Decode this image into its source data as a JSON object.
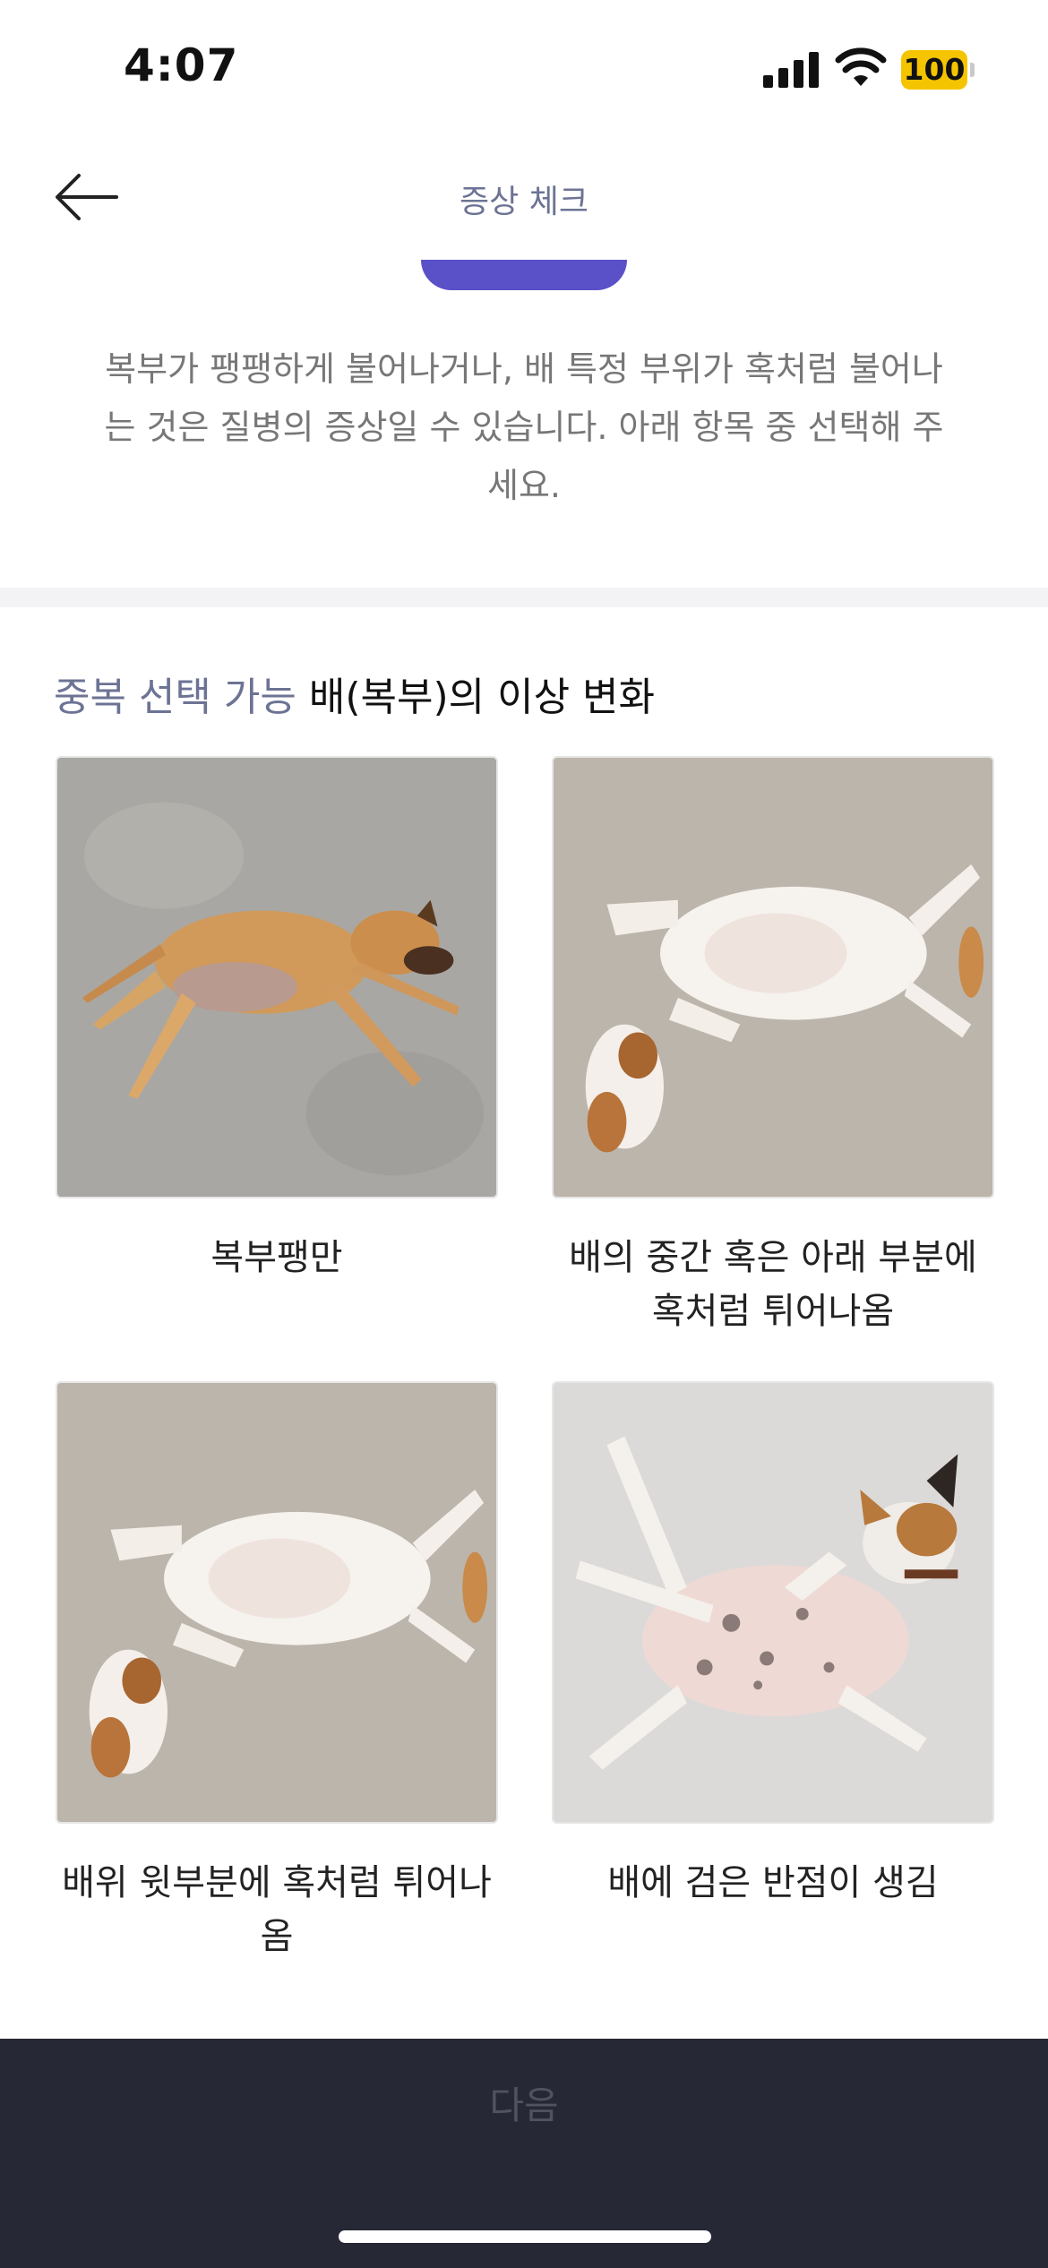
{
  "status_bar": {
    "time": "4:07",
    "battery": "100"
  },
  "nav": {
    "title": "증상 체크"
  },
  "progress": {
    "fraction": 0.5
  },
  "intro": {
    "text": "복부가 팽팽하게 불어나거나, 배 특정 부위가 혹처럼 불어나는 것은 질병의 증상일 수 있습니다. 아래 항목 중 선택해 주세요."
  },
  "section": {
    "tag": "중복 선택 가능",
    "title": "배(복부)의 이상 변화"
  },
  "options": [
    {
      "label": "복부팽만",
      "icon": "dog-lying-side-photo"
    },
    {
      "label": "배의 중간 혹은 아래 부분에 혹처럼 튀어나옴",
      "icon": "dog-belly-up-photo"
    },
    {
      "label": "배위 윗부분에 혹처럼 튀어나옴",
      "icon": "dog-belly-up-photo"
    },
    {
      "label": "배에 검은 반점이 생김",
      "icon": "dog-spotted-belly-photo"
    }
  ],
  "footer": {
    "next_label": "다음"
  },
  "colors": {
    "accent": "#5a50c8",
    "tag": "#6c7394",
    "footer_bg": "#272835",
    "battery": "#f5c400"
  }
}
